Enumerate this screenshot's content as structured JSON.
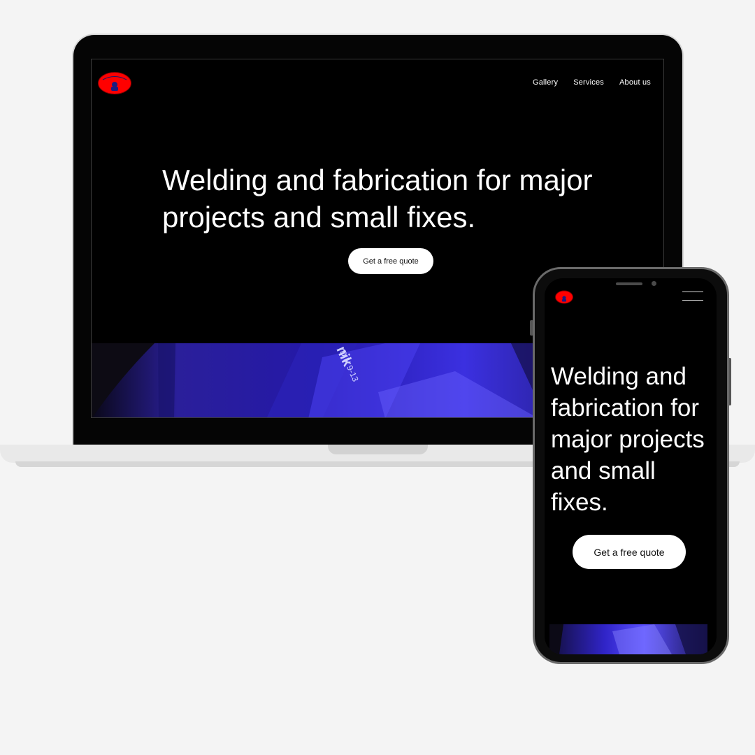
{
  "desktop": {
    "nav": [
      "Gallery",
      "Services",
      "About us"
    ],
    "hero_title": "Welding and fabrication for major projects and small fixes.",
    "cta_label": "Get a free quote",
    "photo": {
      "label_brand": "nik",
      "label_spec": "DIN 9-13"
    }
  },
  "mobile": {
    "hero_title": "Welding and fabrication for major projects and small fixes.",
    "cta_label": "Get a free quote",
    "menu_icon": "hamburger-icon"
  },
  "colors": {
    "page_bg": "#f4f4f4",
    "screen_bg": "#000000",
    "logo_red": "#ff0000",
    "photo_blue": "#3a2fd8",
    "button_bg": "#ffffff"
  },
  "logo": {
    "icon": "welder-mask-logo"
  }
}
